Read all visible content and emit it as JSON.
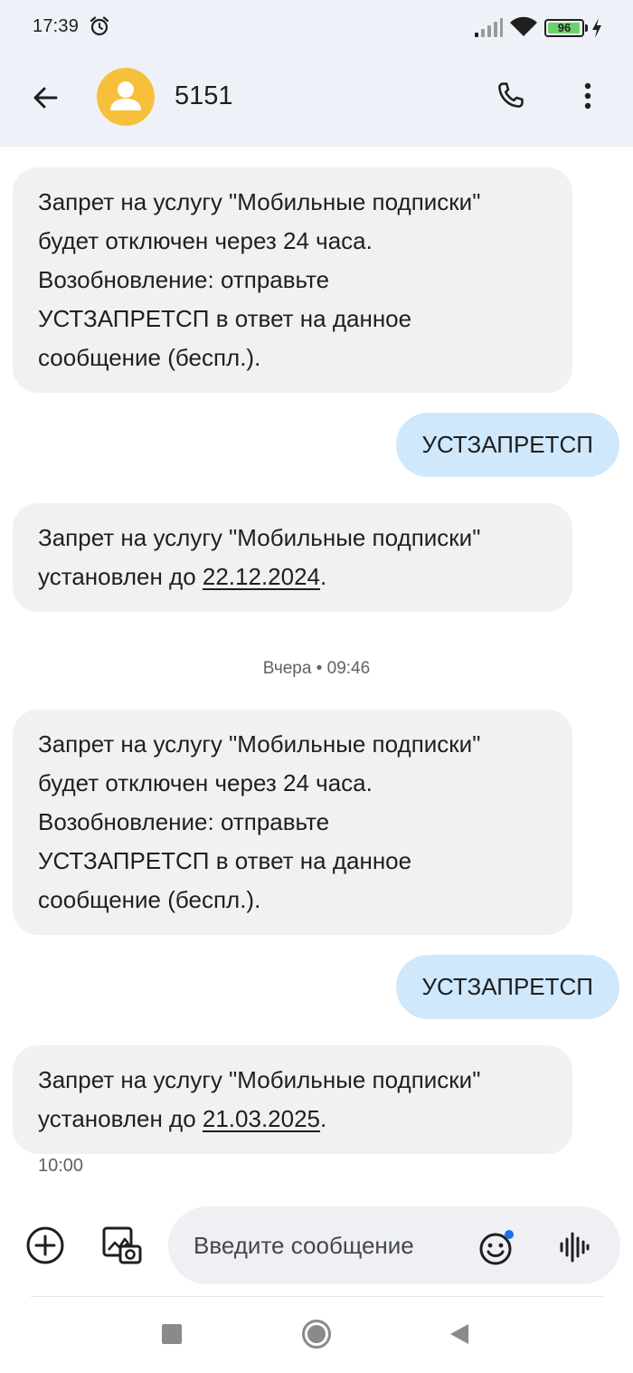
{
  "status_bar": {
    "time": "17:39",
    "battery_level": "96",
    "battery_fraction": 0.96
  },
  "header": {
    "contact_name": "5151"
  },
  "messages": [
    {
      "direction": "incoming",
      "lines": [
        "Запрет на услугу \"Мобильные подписки\"",
        "будет отключен через 24 часа.",
        "Возобновление: отправьте",
        "УСТЗАПРЕТСП в ответ на данное",
        "сообщение (беспл.)."
      ]
    },
    {
      "direction": "outgoing",
      "text": "УСТЗАПРЕТСП"
    },
    {
      "direction": "incoming",
      "line1": "Запрет на услугу \"Мобильные подписки\"",
      "line2_prefix": "установлен до ",
      "date": "22.12.2024",
      "line2_suffix": "."
    },
    {
      "direction": "incoming",
      "lines": [
        "Запрет на услугу \"Мобильные подписки\"",
        "будет отключен через 24 часа.",
        "Возобновление: отправьте",
        "УСТЗАПРЕТСП в ответ на данное",
        "сообщение (беспл.)."
      ]
    },
    {
      "direction": "outgoing",
      "text": "УСТЗАПРЕТСП"
    },
    {
      "direction": "incoming",
      "line1": "Запрет на услугу \"Мобильные подписки\"",
      "line2_prefix": "установлен до ",
      "date": "21.03.2025",
      "line2_suffix": "."
    }
  ],
  "day_separator": "Вчера • 09:46",
  "last_message_time": "10:00",
  "composer": {
    "placeholder": "Введите сообщение"
  },
  "colors": {
    "header_bg": "#eef1f8",
    "incoming_bubble": "#f1f1f1",
    "outgoing_bubble": "#cfe8fc",
    "avatar": "#f7c03a",
    "battery_fill": "#6bd36b",
    "emoji_badge": "#1a73e8"
  },
  "icons": {
    "alarm": "alarm-clock-icon",
    "signal": "signal-icon",
    "wifi": "wifi-icon",
    "battery": "battery-icon",
    "charging": "charging-bolt-icon",
    "back": "arrow-back-icon",
    "avatar": "person-icon",
    "call": "phone-icon",
    "more": "more-vert-icon",
    "add": "add-circle-icon",
    "gallery": "gallery-icon",
    "emoji": "emoji-icon",
    "voice": "voice-wave-icon",
    "nav_recents": "nav-recents-icon",
    "nav_home": "nav-home-icon",
    "nav_back": "nav-back-icon"
  }
}
